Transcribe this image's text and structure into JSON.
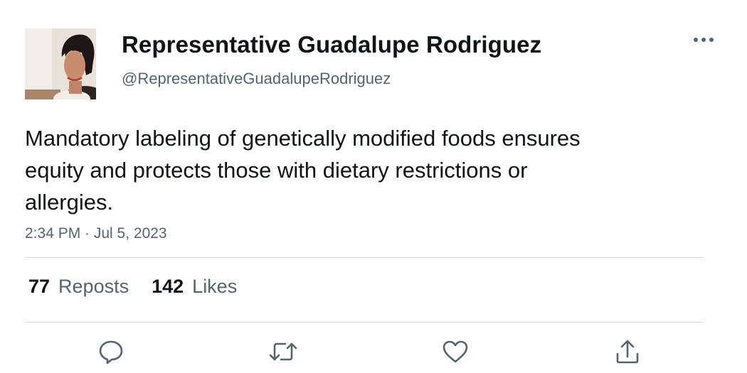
{
  "author": {
    "display_name": "Representative Guadalupe Rodriguez",
    "handle": "@RepresentativeGuadalupeRodriguez"
  },
  "tweet": {
    "text": "Mandatory labeling of genetically modified foods ensures equity and protects those with dietary restrictions or allergies.",
    "timestamp": "2:34 PM · Jul 5, 2023"
  },
  "stats": {
    "reposts_count": "77",
    "reposts_label": "Reposts",
    "likes_count": "142",
    "likes_label": "Likes"
  },
  "actions": [
    {
      "icon": "reply-icon"
    },
    {
      "icon": "repost-icon"
    },
    {
      "icon": "like-icon"
    },
    {
      "icon": "share-icon"
    }
  ],
  "colors": {
    "text_primary": "#0f1419",
    "text_secondary": "#536471",
    "divider": "#cfd9de"
  }
}
